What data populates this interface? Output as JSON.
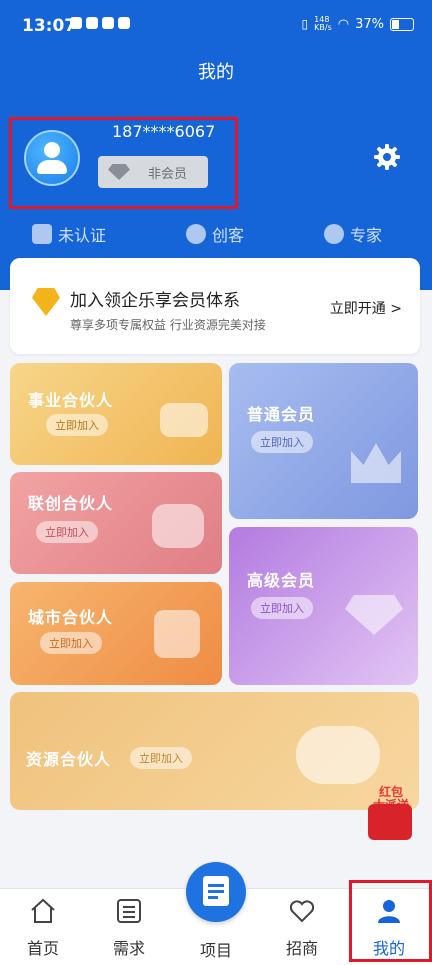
{
  "status_bar": {
    "time": "13:07",
    "speed": "148\nKB/s",
    "battery": "37%"
  },
  "header": {
    "title": "我的"
  },
  "profile": {
    "phone": "187****6067",
    "member_status": "非会员"
  },
  "roles": [
    {
      "label": "未认证",
      "icon": "enterprise-shield-icon"
    },
    {
      "label": "创客",
      "icon": "person-icon"
    },
    {
      "label": "专家",
      "icon": "expert-icon"
    }
  ],
  "join_card": {
    "title": "加入领企乐享会员体系",
    "subtitle": "尊享多项专属权益  行业资源完美对接",
    "action": "立即开通 >"
  },
  "tiles": {
    "shiye": {
      "name": "事业合伙人",
      "button": "立即加入"
    },
    "putong": {
      "name": "普通会员",
      "button": "立即加入"
    },
    "lianchuang": {
      "name": "联创合伙人",
      "button": "立即加入"
    },
    "gaoji": {
      "name": "高级会员",
      "button": "立即加入"
    },
    "chengshi": {
      "name": "城市合伙人",
      "button": "立即加入"
    },
    "ziyuan": {
      "name": "资源合伙人",
      "button": "立即加入"
    }
  },
  "red_packet": {
    "line1": "红包",
    "line2": "大派送"
  },
  "tabbar": {
    "home": "首页",
    "demand": "需求",
    "project": "项目",
    "merchant": "招商",
    "mine": "我的"
  },
  "colors": {
    "brand_blue": "#1565d8",
    "highlight_red": "#e0182b"
  }
}
